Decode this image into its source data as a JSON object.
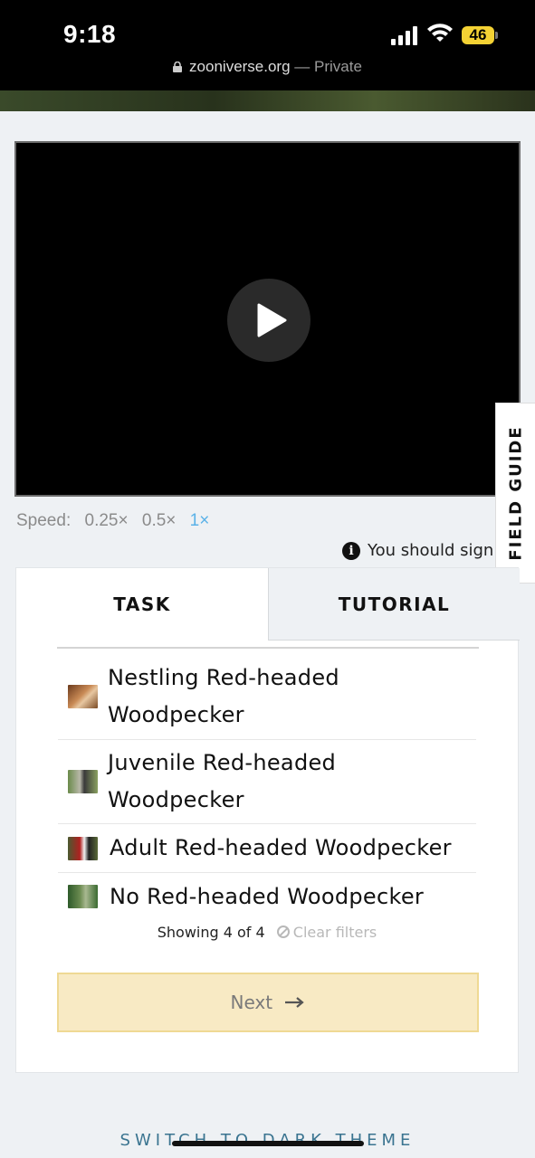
{
  "status_bar": {
    "time": "9:18",
    "battery": "46",
    "url": "zooniverse.org",
    "url_suffix": "— Private"
  },
  "video": {
    "play_icon": "play-icon"
  },
  "speed": {
    "label": "Speed:",
    "options": [
      "0.25×",
      "0.5×",
      "1×"
    ],
    "active": "1×"
  },
  "notice": {
    "text": "You should sign in"
  },
  "field_guide": {
    "label": "FIELD GUIDE"
  },
  "tabs": {
    "task": "TASK",
    "tutorial": "TUTORIAL"
  },
  "choices": [
    {
      "line1": "Nestling Red-headed",
      "line2": "Woodpecker"
    },
    {
      "line1": "Juvenile Red-headed",
      "line2": "Woodpecker"
    },
    {
      "line1": "Adult Red-headed Woodpecker"
    },
    {
      "line1": "No Red-headed Woodpecker"
    }
  ],
  "filter": {
    "showing": "Showing 4 of 4",
    "clear": "Clear filters"
  },
  "next_button": {
    "label": "Next"
  },
  "footer": {
    "theme_toggle": "SWITCH TO DARK THEME"
  },
  "colors": {
    "active_speed": "#5ab2e8",
    "next_bg": "#f8eac4",
    "theme_link": "#3a7490"
  }
}
